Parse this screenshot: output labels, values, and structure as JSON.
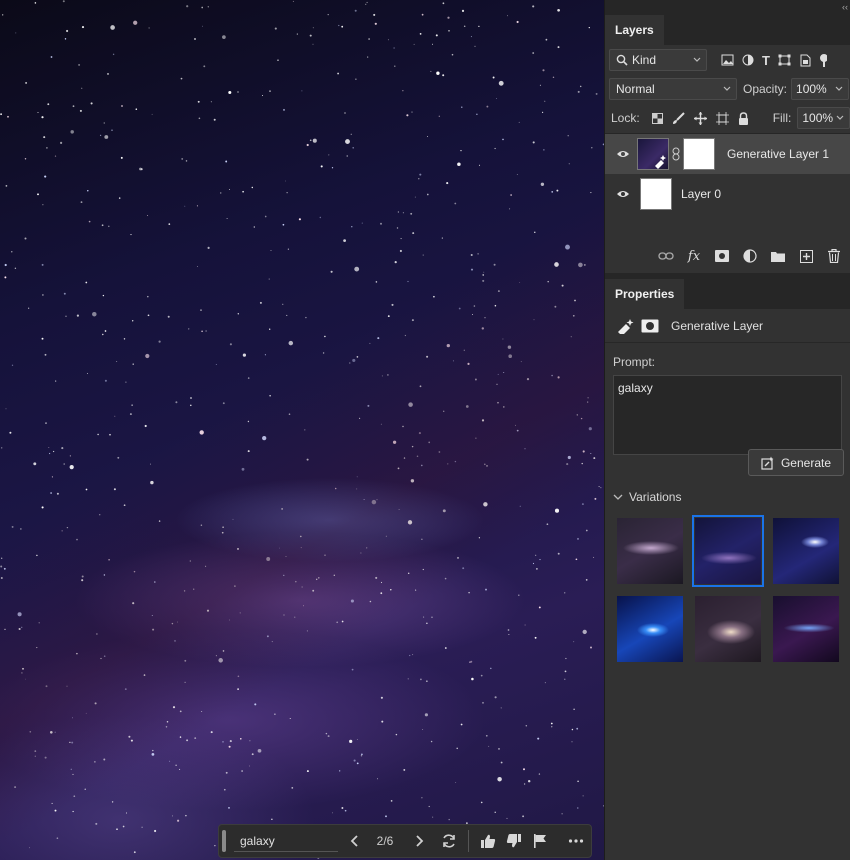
{
  "layers_panel": {
    "tab_label": "Layers",
    "filter": {
      "label": "Kind"
    },
    "blend_mode": {
      "value": "Normal"
    },
    "opacity": {
      "label": "Opacity:",
      "value": "100%"
    },
    "lock": {
      "label": "Lock:"
    },
    "fill": {
      "label": "Fill:",
      "value": "100%"
    },
    "layers": [
      {
        "name": "Generative Layer 1",
        "visible": true,
        "selected": true
      },
      {
        "name": "Layer 0",
        "visible": true,
        "selected": false
      }
    ],
    "bottom_icons": [
      "link-icon",
      "fx-icon",
      "mask-icon",
      "adjustment-icon",
      "folder-icon",
      "new-layer-icon",
      "trash-icon"
    ],
    "fx_label": "fx"
  },
  "properties_panel": {
    "tab_label": "Properties",
    "layer_type": "Generative Layer",
    "prompt_label": "Prompt:",
    "prompt_value": "galaxy",
    "generate_label": "Generate",
    "variations_label": "Variations",
    "variations": [
      {
        "selected": false
      },
      {
        "selected": true
      },
      {
        "selected": false
      },
      {
        "selected": false
      },
      {
        "selected": false
      },
      {
        "selected": false
      }
    ]
  },
  "gen_toolbar": {
    "prompt": "galaxy",
    "counter": "2/6"
  },
  "colors": {
    "panel_bg": "#323232",
    "selected_row": "#474747",
    "accent": "#1a73e8"
  }
}
